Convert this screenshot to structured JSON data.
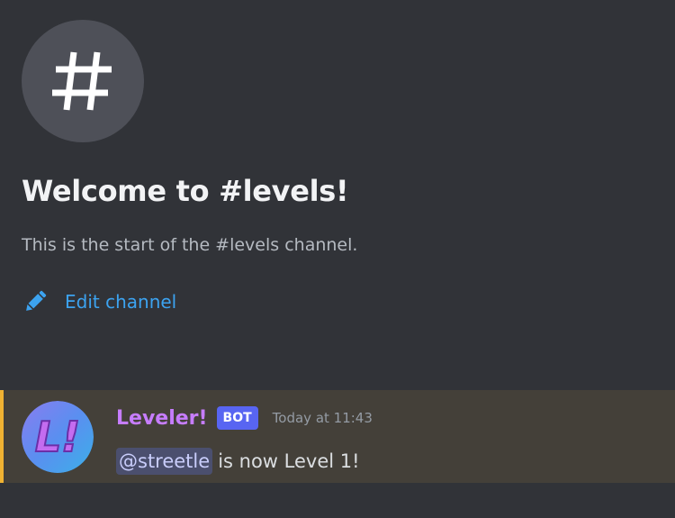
{
  "channel": {
    "icon": "hash-icon",
    "welcome_title": "Welcome to #levels!",
    "welcome_subtitle": "This is the start of the #levels channel.",
    "edit_label": "Edit channel",
    "edit_icon": "pencil-icon"
  },
  "message": {
    "author": "Leveler!",
    "bot_tag": "BOT",
    "timestamp": "Today at 11:43",
    "mention": "@streetle",
    "text": "is now Level 1!",
    "avatar_text": "L!",
    "highlight_color": "#f0b232",
    "author_color": "#c77dff"
  },
  "colors": {
    "background": "#313338",
    "link": "#3ca3f0",
    "bot_tag": "#5865f2"
  }
}
